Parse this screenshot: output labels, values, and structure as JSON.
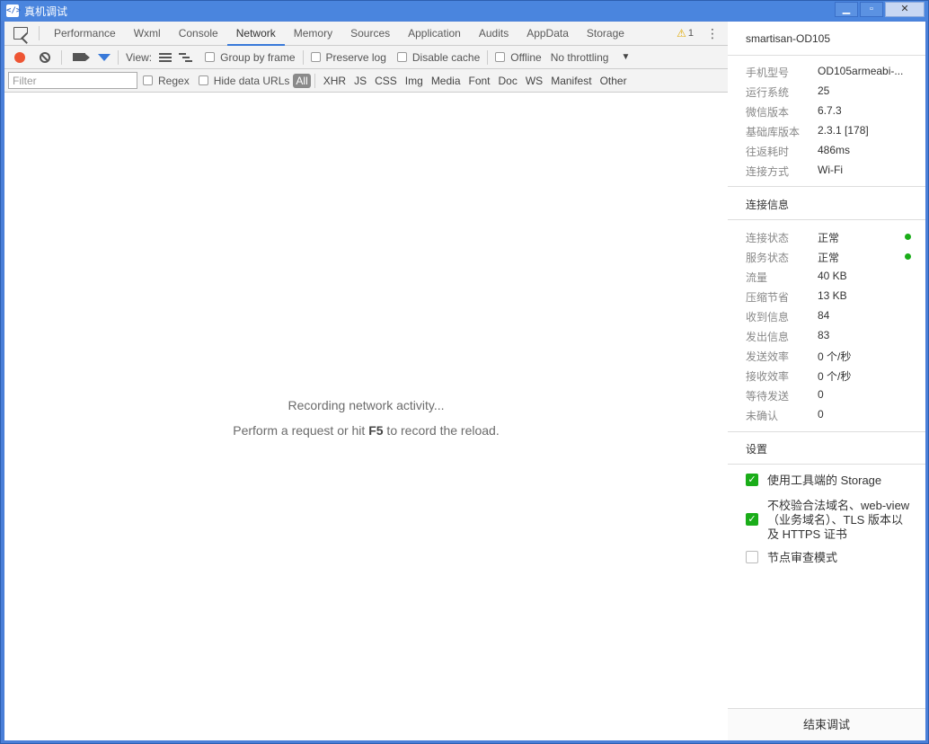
{
  "window": {
    "title": "真机调试",
    "app_icon": "code-icon",
    "minimize": "▁",
    "maximize": "▫",
    "close": "✕"
  },
  "tabs": [
    "Performance",
    "Wxml",
    "Console",
    "Network",
    "Memory",
    "Sources",
    "Application",
    "Audits",
    "AppData",
    "Storage"
  ],
  "active_tab": "Network",
  "warning_count": "1",
  "toolbar": {
    "view_label": "View:",
    "group_by_frame": "Group by frame",
    "preserve_log": "Preserve log",
    "disable_cache": "Disable cache",
    "offline": "Offline",
    "throttling": "No throttling"
  },
  "filterbar": {
    "placeholder": "Filter",
    "regex": "Regex",
    "hide_data_urls": "Hide data URLs",
    "types": [
      "All",
      "XHR",
      "JS",
      "CSS",
      "Img",
      "Media",
      "Font",
      "Doc",
      "WS",
      "Manifest",
      "Other"
    ]
  },
  "empty_state": {
    "line1": "Recording network activity...",
    "line2_pre": "Perform a request or hit ",
    "line2_key": "F5",
    "line2_post": " to record the reload."
  },
  "sidebar": {
    "device_name": "smartisan-OD105",
    "device_info": [
      {
        "label": "手机型号",
        "value": "OD105armeabi-..."
      },
      {
        "label": "运行系统",
        "value": "25"
      },
      {
        "label": "微信版本",
        "value": "6.7.3"
      },
      {
        "label": "基础库版本",
        "value": "2.3.1 [178]"
      },
      {
        "label": "往返耗时",
        "value": "486ms"
      },
      {
        "label": "连接方式",
        "value": "Wi-Fi"
      }
    ],
    "connection_title": "连接信息",
    "connection_info": [
      {
        "label": "连接状态",
        "value": "正常",
        "status_color": "#1aad19"
      },
      {
        "label": "服务状态",
        "value": "正常",
        "status_color": "#1aad19"
      },
      {
        "label": "流量",
        "value": "40 KB"
      },
      {
        "label": "压缩节省",
        "value": "13 KB"
      },
      {
        "label": "收到信息",
        "value": "84"
      },
      {
        "label": "发出信息",
        "value": "83"
      },
      {
        "label": "发送效率",
        "value": "0 个/秒"
      },
      {
        "label": "接收效率",
        "value": "0 个/秒"
      },
      {
        "label": "等待发送",
        "value": "0"
      },
      {
        "label": "未确认",
        "value": "0"
      }
    ],
    "settings_title": "设置",
    "settings": [
      {
        "label": "使用工具端的 Storage",
        "checked": true
      },
      {
        "label": "不校验合法域名、web-view（业务域名）、TLS 版本以及 HTTPS 证书",
        "checked": true
      },
      {
        "label": "节点审查模式",
        "checked": false
      }
    ],
    "end_button": "结束调试"
  }
}
